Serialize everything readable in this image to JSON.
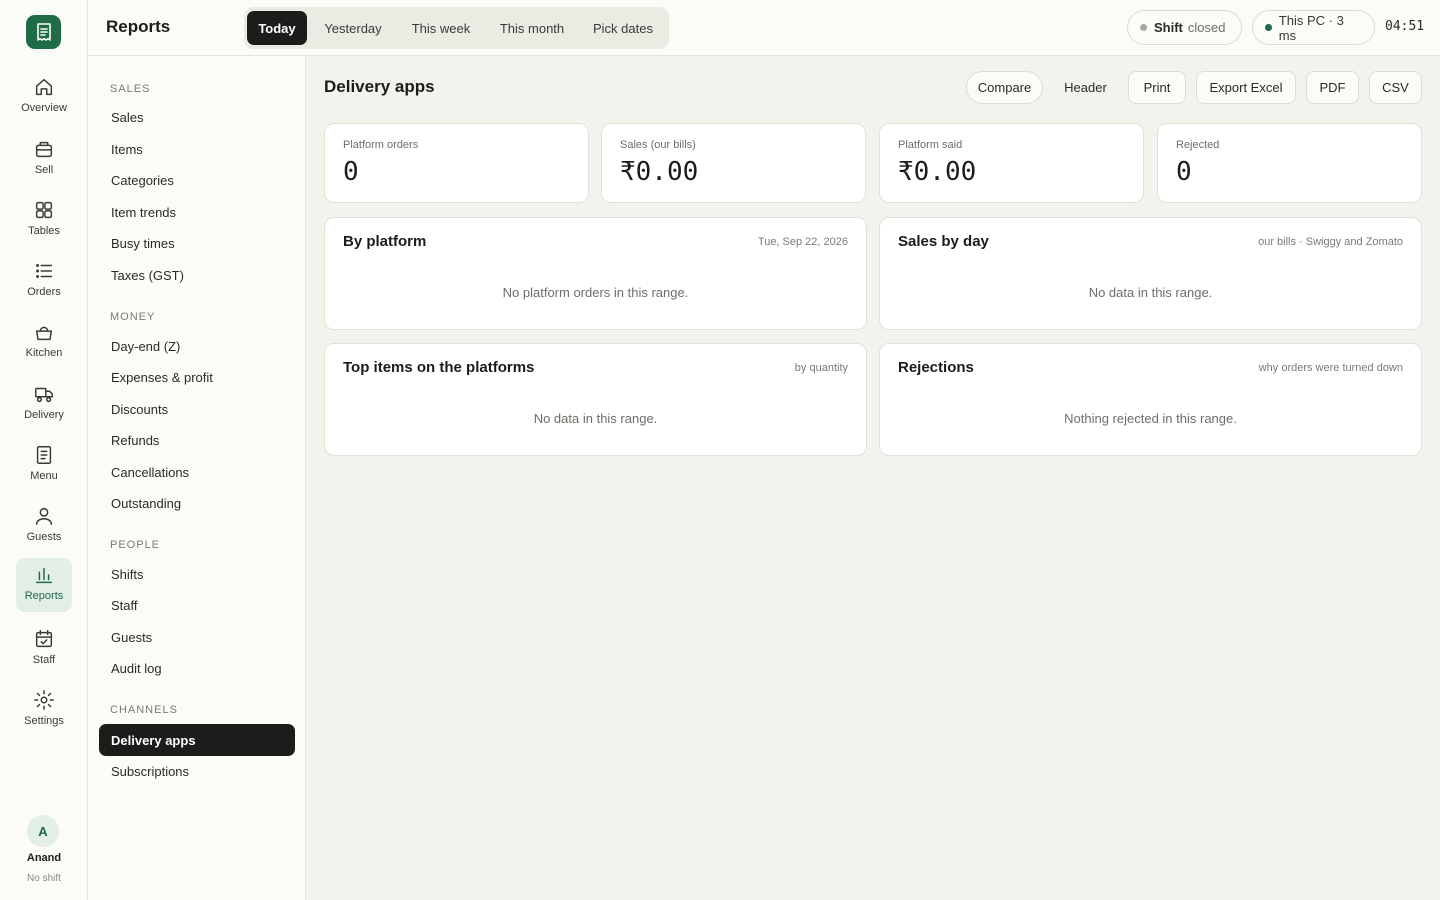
{
  "rail": {
    "items": [
      {
        "key": "overview",
        "label": "Overview",
        "icon": "home-icon"
      },
      {
        "key": "sell",
        "label": "Sell",
        "icon": "register-icon"
      },
      {
        "key": "tables",
        "label": "Tables",
        "icon": "grid-icon"
      },
      {
        "key": "orders",
        "label": "Orders",
        "icon": "list-icon"
      },
      {
        "key": "kitchen",
        "label": "Kitchen",
        "icon": "basket-icon"
      },
      {
        "key": "delivery",
        "label": "Delivery",
        "icon": "delivery-icon"
      },
      {
        "key": "menu",
        "label": "Menu",
        "icon": "document-icon"
      },
      {
        "key": "guests",
        "label": "Guests",
        "icon": "user-icon"
      },
      {
        "key": "reports",
        "label": "Reports",
        "icon": "bar-chart-icon"
      },
      {
        "key": "staff",
        "label": "Staff",
        "icon": "calendar-icon"
      },
      {
        "key": "settings",
        "label": "Settings",
        "icon": "gear-icon"
      }
    ],
    "active": "reports",
    "user": {
      "initial": "A",
      "name": "Anand",
      "shift": "No shift"
    },
    "brand_color": "#1f6b45"
  },
  "topbar": {
    "title": "Reports",
    "ranges": [
      "Today",
      "Yesterday",
      "This week",
      "This month",
      "Pick dates"
    ],
    "active_range": "Today",
    "shift": {
      "label": "Shift",
      "status": "closed",
      "dot_color": "#a8a8a2"
    },
    "device": {
      "label": "This PC · 3 ms",
      "dot_color": "#1f6b45"
    },
    "clock": "04:51"
  },
  "subnav": {
    "sections": [
      {
        "title": "Sales",
        "items": [
          "Sales",
          "Items",
          "Categories",
          "Item trends",
          "Busy times",
          "Taxes (GST)"
        ]
      },
      {
        "title": "Money",
        "items": [
          "Day-end (Z)",
          "Expenses & profit",
          "Discounts",
          "Refunds",
          "Cancellations",
          "Outstanding"
        ]
      },
      {
        "title": "People",
        "items": [
          "Shifts",
          "Staff",
          "Guests",
          "Audit log"
        ]
      },
      {
        "title": "Channels",
        "items": [
          "Delivery apps",
          "Subscriptions"
        ]
      }
    ],
    "active": "Delivery apps"
  },
  "main": {
    "title": "Delivery apps",
    "actions": {
      "compare": "Compare",
      "header": "Header",
      "print": "Print",
      "excel": "Export Excel",
      "pdf": "PDF",
      "csv": "CSV"
    },
    "stats": [
      {
        "label": "Platform orders",
        "value": "0"
      },
      {
        "label": "Sales (our bills)",
        "value": "₹0.00"
      },
      {
        "label": "Platform said",
        "value": "₹0.00"
      },
      {
        "label": "Rejected",
        "value": "0"
      }
    ],
    "cards": [
      {
        "title": "By platform",
        "meta": "Tue, Sep 22, 2026",
        "empty": "No platform orders in this range."
      },
      {
        "title": "Sales by day",
        "meta": "our bills · Swiggy and Zomato",
        "empty": "No data in this range."
      },
      {
        "title": "Top items on the platforms",
        "meta": "by quantity",
        "empty": "No data in this range."
      },
      {
        "title": "Rejections",
        "meta": "why orders were turned down",
        "empty": "Nothing rejected in this range."
      }
    ]
  }
}
